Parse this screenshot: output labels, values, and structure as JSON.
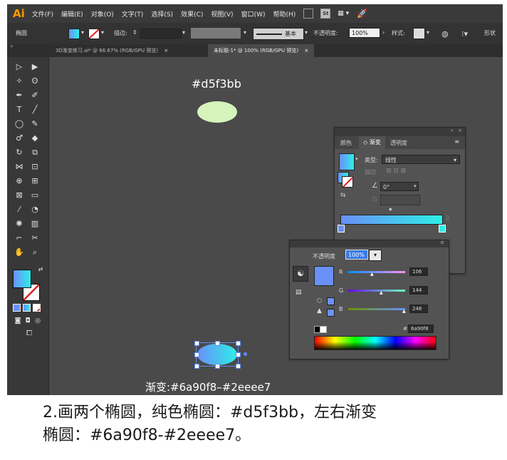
{
  "app": {
    "logo": "Ai",
    "menu": [
      "文件(F)",
      "编辑(E)",
      "对象(O)",
      "文字(T)",
      "选择(S)",
      "效果(C)",
      "视图(V)",
      "窗口(W)",
      "帮助(H)"
    ],
    "menu_extra": "St"
  },
  "control_bar": {
    "label_left": "椭圆",
    "stroke_label": "描边:",
    "stroke_style": "基本",
    "opacity_label": "不透明度:",
    "opacity_value": "100%",
    "style_label": "样式:",
    "right_label": "形状"
  },
  "tabs": [
    {
      "label": "3D渐变练习.ai* @ 66.67% (RGB/GPU 预览)"
    },
    {
      "label": "未标题-1* @ 100% (RGB/GPU 预览)"
    }
  ],
  "canvas": {
    "solid_label": "#d5f3bb",
    "solid_color": "#d5f3bb",
    "gradient_label": "渐变:#6a90f8–#2eeee7",
    "gradient_start": "#6a90f8",
    "gradient_end": "#2eeee7"
  },
  "gradient_panel": {
    "tabs": [
      "颜色",
      "渐变",
      "透明度"
    ],
    "type_label": "类型:",
    "type_value": "线性",
    "angle_value": "0°"
  },
  "color_panel": {
    "opacity_label": "不透明度",
    "opacity_value": "100%",
    "r_label": "R",
    "r_value": "106",
    "g_label": "G",
    "g_value": "144",
    "b_label": "B",
    "b_value": "248",
    "hex_label": "#",
    "hex_value": "6a90f8",
    "swatch_color": "#6a90f8"
  },
  "caption": {
    "line1": "2.画两个椭圆，纯色椭圆：#d5f3bb，左右渐变",
    "line2": "椭圆：#6a90f8-#2eeee7。"
  }
}
